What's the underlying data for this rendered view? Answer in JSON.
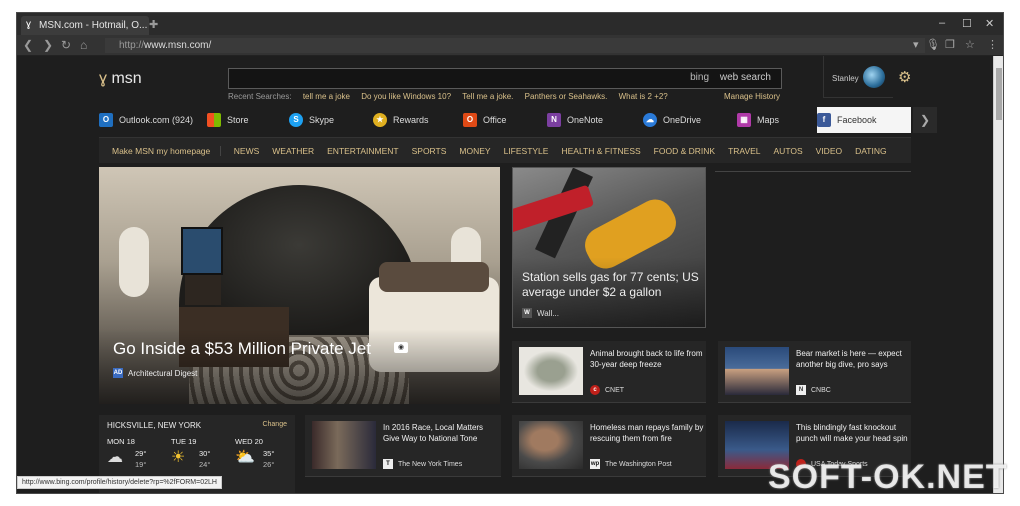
{
  "browser": {
    "tab_title": "MSN.com - Hotmail, O...",
    "url_prefix": "http://",
    "url_host": "www.msn.com/",
    "status_url": "http://www.bing.com/profile/history/delete?rp=%2fFORM=02LH"
  },
  "header": {
    "logo_text": "msn",
    "bing_label": "bing",
    "search_button": "web search",
    "recent_label": "Recent Searches:",
    "recent_searches": [
      "tell me a joke",
      "Do you like Windows 10?",
      "Tell me a joke.",
      "Panthers or Seahawks.",
      "What is 2 +2?"
    ],
    "manage_history": "Manage History",
    "user_name": "Stanley"
  },
  "apps": [
    {
      "label": "Outlook.com (924)",
      "icon": "outlook-icon",
      "color": "#1f6fc0"
    },
    {
      "label": "Store",
      "icon": "store-icon",
      "color": "#e74c3c"
    },
    {
      "label": "Skype",
      "icon": "skype-icon",
      "color": "#1da1f2"
    },
    {
      "label": "Rewards",
      "icon": "rewards-icon",
      "color": "#e0b020"
    },
    {
      "label": "Office",
      "icon": "office-icon",
      "color": "#e04a16"
    },
    {
      "label": "OneNote",
      "icon": "onenote-icon",
      "color": "#7b3fa0"
    },
    {
      "label": "OneDrive",
      "icon": "onedrive-icon",
      "color": "#2a7ad8"
    },
    {
      "label": "Maps",
      "icon": "maps-icon",
      "color": "#b03aa8"
    },
    {
      "label": "Facebook",
      "icon": "facebook-icon",
      "color": "#3b5998"
    }
  ],
  "nav": {
    "home_label": "Make MSN my homepage",
    "items": [
      "NEWS",
      "WEATHER",
      "ENTERTAINMENT",
      "SPORTS",
      "MONEY",
      "LIFESTYLE",
      "HEALTH & FITNESS",
      "FOOD & DRINK",
      "TRAVEL",
      "AUTOS",
      "VIDEO",
      "DATING"
    ]
  },
  "hero": {
    "title": "Go Inside a $53 Million Private Jet",
    "source": "Architectural Digest"
  },
  "gas_story": {
    "title": "Station sells gas for 77 cents; US average under $2 a gallon",
    "source": "Wall..."
  },
  "cards": [
    {
      "title": "Animal brought back to life from 30-year deep freeze",
      "source": "CNET"
    },
    {
      "title": "Bear market is here — expect another big dive, pro says",
      "source": "CNBC"
    },
    {
      "title": "In 2016 Race, Local Matters Give Way to National Tone",
      "source": "The New York Times"
    },
    {
      "title": "Homeless man repays family by rescuing them from fire",
      "source": "The Washington Post"
    },
    {
      "title": "This blindingly fast knockout punch will make your head spin",
      "source": "USA Today Sports"
    }
  ],
  "weather": {
    "location": "HICKSVILLE, NEW YORK",
    "change_label": "Change",
    "days": [
      {
        "day": "MON 18",
        "hi": "29°",
        "lo": "19°",
        "icon": "cloud-icon"
      },
      {
        "day": "TUE 19",
        "hi": "30°",
        "lo": "24°",
        "icon": "sun-icon"
      },
      {
        "day": "WED 20",
        "hi": "35°",
        "lo": "26°",
        "icon": "partly-sunny-icon"
      }
    ]
  },
  "watermark": "SOFT-OK.NET"
}
